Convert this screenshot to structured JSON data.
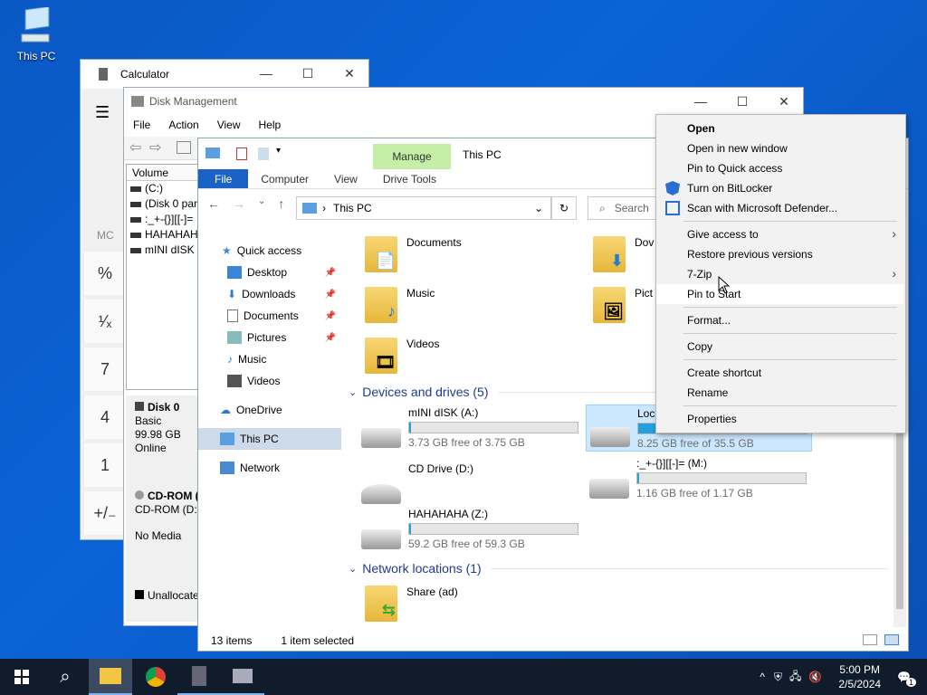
{
  "desktop": {
    "icon_label": "This PC"
  },
  "calculator": {
    "title": "Calculator",
    "mc": "MC",
    "keys": [
      "%",
      "¹⁄ₓ",
      "7",
      "4",
      "1",
      "+/₋"
    ]
  },
  "disk_mgmt": {
    "title": "Disk Management",
    "menu": [
      "File",
      "Action",
      "View",
      "Help"
    ],
    "volume_header": "Volume",
    "volumes": [
      "(C:)",
      "(Disk 0 part",
      ":_+-{}][[-]=",
      "HAHAHAH",
      "mINI dISK ("
    ],
    "disk0": {
      "name": "Disk 0",
      "type": "Basic",
      "size": "99.98 GB",
      "status": "Online"
    },
    "cdrom": {
      "name": "CD-ROM (",
      "drive": "CD-ROM (D:)",
      "media": "No Media"
    },
    "unallocated": "Unallocated"
  },
  "explorer": {
    "manage_tab": "Manage",
    "title": "This PC",
    "ribbon": [
      "File",
      "Computer",
      "View",
      "Drive Tools"
    ],
    "address": "This PC",
    "search_placeholder": "Search",
    "sidebar": {
      "quick_access": "Quick access",
      "items": [
        "Desktop",
        "Downloads",
        "Documents",
        "Pictures",
        "Music",
        "Videos"
      ],
      "onedrive": "OneDrive",
      "thispc": "This PC",
      "network": "Network"
    },
    "folders": [
      "Documents",
      "Dov",
      "Music",
      "Pict",
      "Videos"
    ],
    "devices_header": "Devices and drives (5)",
    "drives": [
      {
        "name": "mINI dISK (A:)",
        "free": "3.73 GB free of 3.75 GB",
        "used_pct": 1
      },
      {
        "name": "Loca",
        "free": "8.25 GB free of 35.5 GB",
        "used_pct": 77
      },
      {
        "name": "CD Drive (D:)",
        "free": "",
        "used_pct": 0
      },
      {
        "name": ":_+-{}][[-]= (M:)",
        "free": "1.16 GB free of 1.17 GB",
        "used_pct": 1
      },
      {
        "name": "HAHAHAHA (Z:)",
        "free": "59.2 GB free of 59.3 GB",
        "used_pct": 1
      }
    ],
    "network_header": "Network locations (1)",
    "share": "Share (ad)",
    "status_items": "13 items",
    "status_selected": "1 item selected"
  },
  "context_menu": {
    "items": [
      "Open",
      "Open in new window",
      "Pin to Quick access",
      "Turn on BitLocker",
      "Scan with Microsoft Defender...",
      "Give access to",
      "Restore previous versions",
      "7-Zip",
      "Pin to Start",
      "Format...",
      "Copy",
      "Create shortcut",
      "Rename",
      "Properties"
    ]
  },
  "taskbar": {
    "time": "5:00 PM",
    "date": "2/5/2024",
    "notif_count": "1"
  },
  "colors": {
    "accent": "#1a62c5",
    "manage_tab": "#c5efa6",
    "taskbar": "#101b2c",
    "drive_bar": "#26a0da"
  }
}
